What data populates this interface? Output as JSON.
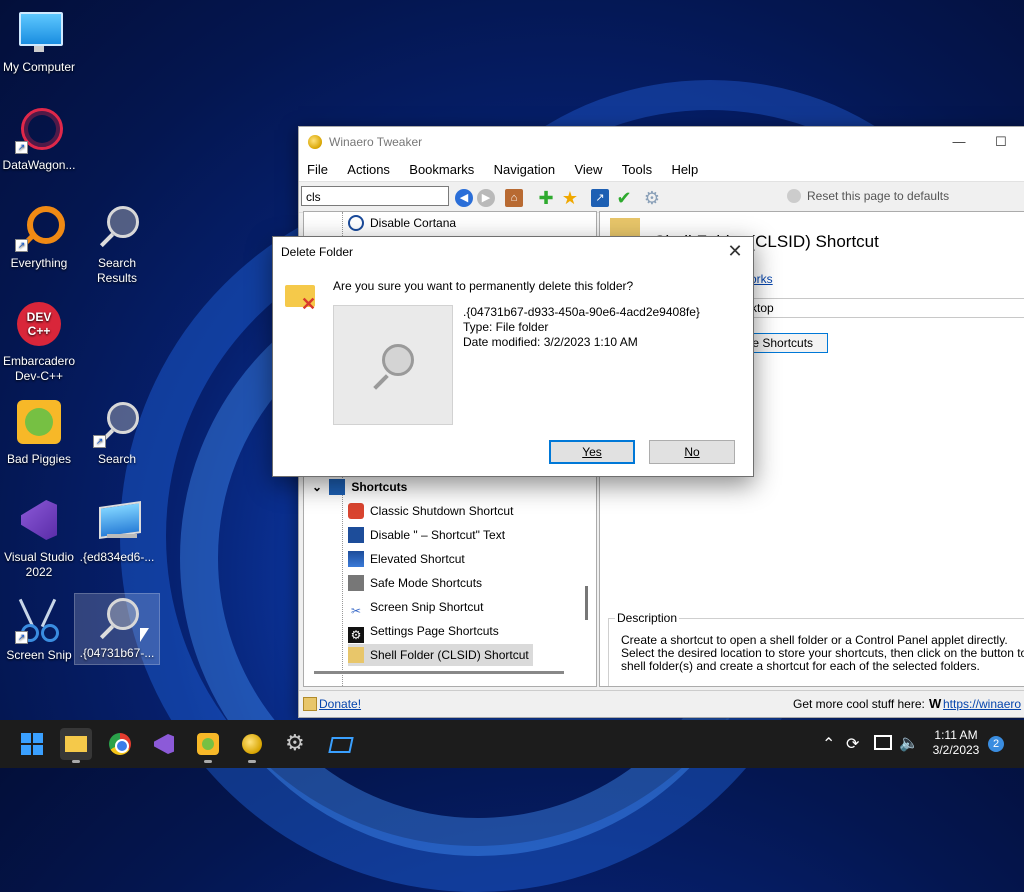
{
  "desktop": {
    "icons": [
      {
        "label": "My Computer",
        "icon": "monitor-icon"
      },
      {
        "label": "DataWagon...",
        "icon": "datawagon-icon"
      },
      {
        "label": "Everything",
        "icon": "everything-search-icon"
      },
      {
        "label": "Search\nResults",
        "icon": "search-results-icon"
      },
      {
        "label": "Embarcadero\nDev-C++",
        "icon": "devcpp-icon"
      },
      {
        "label": "Bad Piggies",
        "icon": "bad-piggies-icon"
      },
      {
        "label": "Search",
        "icon": "search-icon"
      },
      {
        "label": "Visual Studio\n2022",
        "icon": "visual-studio-icon"
      },
      {
        "label": ".{ed834ed6-...",
        "icon": "clsid-folder-icon"
      },
      {
        "label": "Screen Snip",
        "icon": "scissors-icon"
      },
      {
        "label": ".{04731b67-...",
        "icon": "magnifier-folder-icon"
      }
    ]
  },
  "tweaker": {
    "title": "Winaero Tweaker",
    "menu": [
      "File",
      "Actions",
      "Bookmarks",
      "Navigation",
      "View",
      "Tools",
      "Help"
    ],
    "search_value": "cls",
    "reset_label": "Reset this page to defaults",
    "tree": {
      "top_item": "Disable Cortana",
      "section": "Shortcuts",
      "items": [
        "Classic Shutdown Shortcut",
        "Disable \" – Shortcut\" Text",
        "Elevated Shortcut",
        "Safe Mode Shortcuts",
        "Screen Snip Shortcut",
        "Settings Page Shortcuts",
        "Shell Folder (CLSID) Shortcut"
      ],
      "selected": "Shell Folder (CLSID) Shortcut"
    },
    "page": {
      "heading": "Shell Folder (CLSID) Shortcut",
      "link_fragment": "orks",
      "field_fragment": "ktop",
      "button_fragment": "te Shortcuts",
      "description_title": "Description",
      "description_lines": [
        "Create a shortcut to open a shell folder or a Control Panel applet directly.",
        "Select the desired location to store your shortcuts, then click on the button to select th",
        "shell folder(s) and create a shortcut for each of the selected folders."
      ]
    },
    "status": {
      "donate": "Donate!",
      "more": "Get more cool stuff here:",
      "url": "https://winaero"
    }
  },
  "dialog": {
    "title": "Delete Folder",
    "question": "Are you sure you want to permanently delete this folder?",
    "name": ".{04731b67-d933-450a-90e6-4acd2e9408fe}",
    "type": "Type: File folder",
    "modified": "Date modified: 3/2/2023 1:10 AM",
    "yes": "Yes",
    "no": "No"
  },
  "taskbar": {
    "time": "1:11 AM",
    "date": "3/2/2023",
    "notification_count": "2"
  }
}
